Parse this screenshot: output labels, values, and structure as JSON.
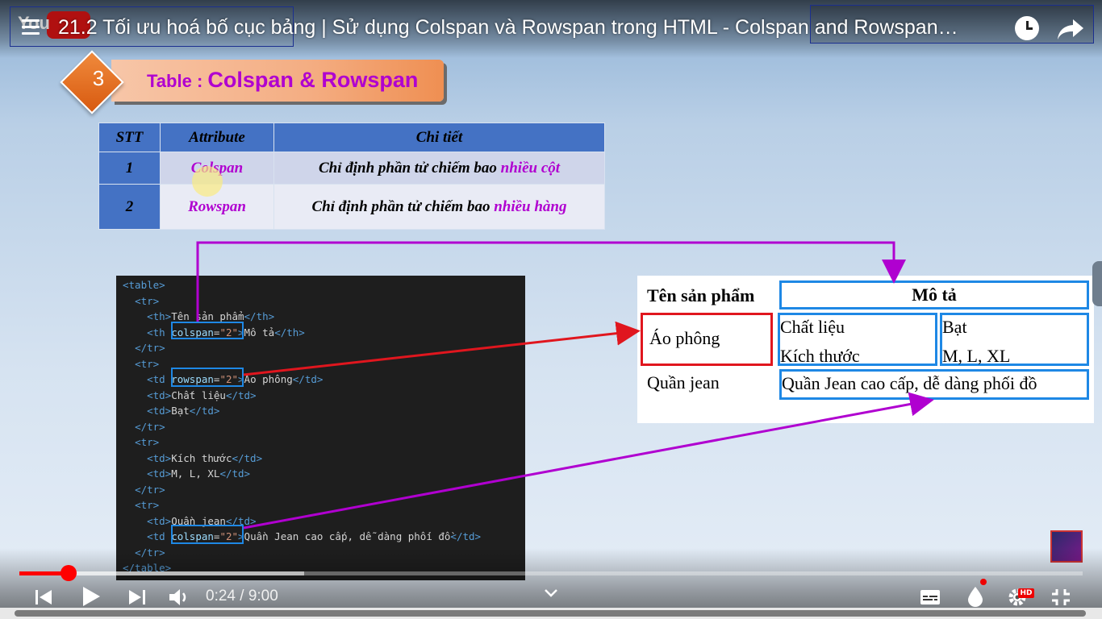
{
  "video": {
    "title": "21.2 Tối ưu hoá bố cục bảng | Sử dụng Colspan và Rowspan trong HTML - Colspan and Rowspan…",
    "current_time": "0:24",
    "duration": "9:00",
    "time_display": "0:24 / 9:00",
    "played_fraction": 0.046,
    "buffered_fraction": 0.268,
    "hd_label": "HD",
    "logo_text": "You"
  },
  "slide": {
    "number": "3",
    "header_small": "Table : ",
    "header_big": "Colspan & Rowspan",
    "accent_color": "#b000d0",
    "table": {
      "headers": [
        "STT",
        "Attribute",
        "Chi tiết"
      ],
      "rows": [
        {
          "stt": "1",
          "attribute": "Colspan",
          "detail_prefix": "Chỉ định phần tử chiếm bao ",
          "detail_highlight": "nhiều cột"
        },
        {
          "stt": "2",
          "attribute": "Rowspan",
          "detail_prefix": "Chỉ định phần tử chiếm bao ",
          "detail_highlight": "nhiều hàng"
        }
      ]
    }
  },
  "preview": {
    "th1": "Tên sản phẩm",
    "th2": "Mô tả",
    "ao": "Áo phông",
    "chat_lieu": "Chất liệu",
    "kich_thuoc": "Kích thước",
    "bat": "Bạt",
    "size": "M, L, XL",
    "quan": "Quần jean",
    "quan_desc": "Quần Jean cao cấp, dễ dàng phối đồ"
  },
  "icons": {
    "menu": "menu-icon",
    "clock": "watch-later-icon",
    "share": "share-icon",
    "prev": "previous-icon",
    "play": "play-icon",
    "next": "next-icon",
    "volume": "volume-icon",
    "chevron": "chevron-down-icon",
    "subtitles": "subtitles-icon",
    "ambient": "ambient-mode-icon",
    "settings": "settings-icon",
    "fullscreen": "exit-fullscreen-icon"
  }
}
